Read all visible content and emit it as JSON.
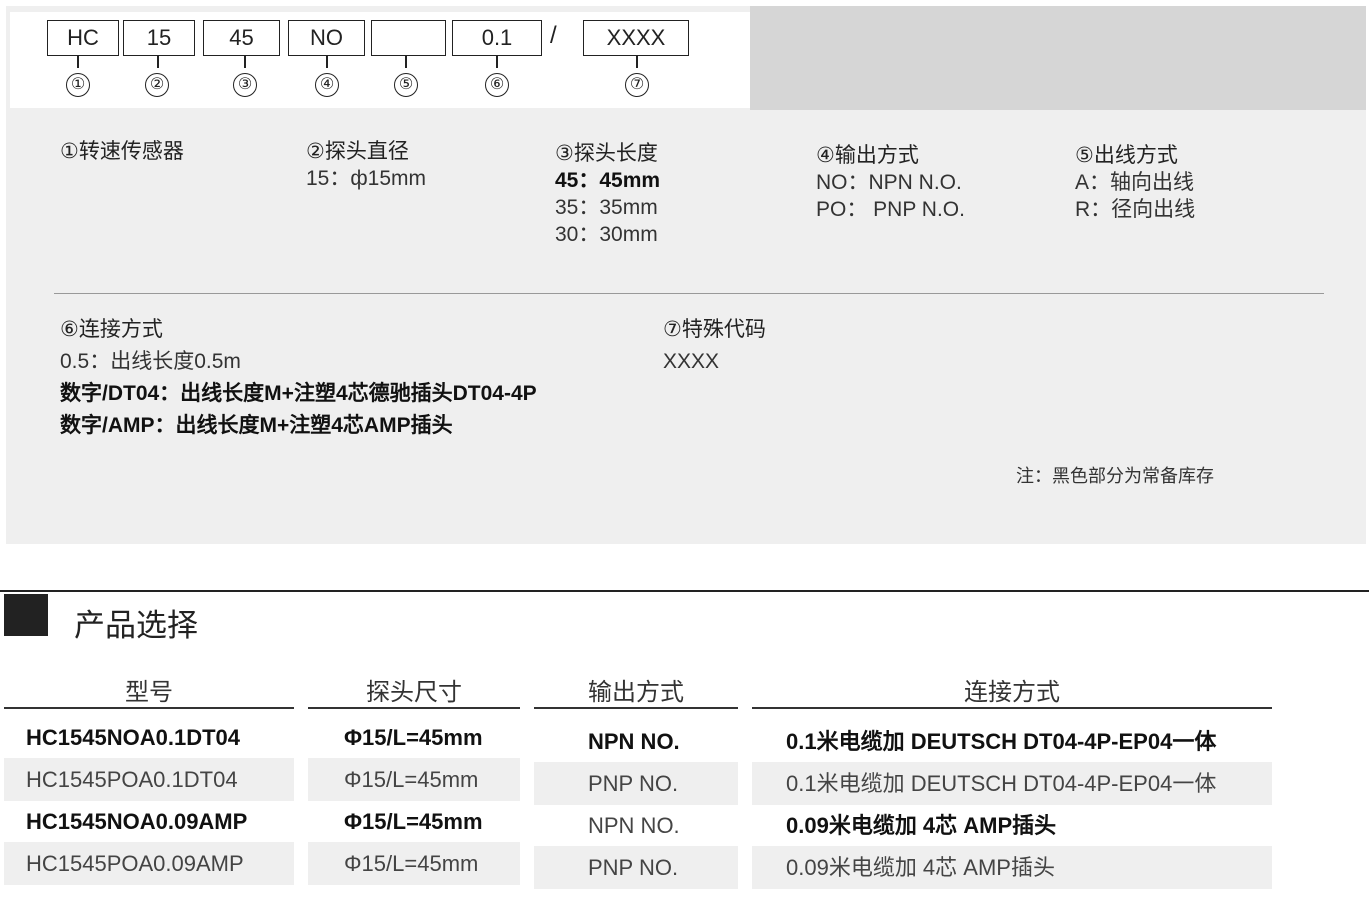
{
  "code": {
    "boxes": [
      "HC",
      "15",
      "45",
      "NO",
      "",
      "0.1",
      "XXXX"
    ],
    "slash": "/",
    "markers": [
      "①",
      "②",
      "③",
      "④",
      "⑤",
      "⑥",
      "⑦"
    ]
  },
  "params": {
    "p1": {
      "heading": "①转速传感器"
    },
    "p2": {
      "heading": "②探头直径",
      "lines": [
        "15：ф15mm"
      ]
    },
    "p3": {
      "heading": "③探头长度",
      "lines": [
        "45：45mm",
        "35：35mm",
        "30：30mm"
      ]
    },
    "p4": {
      "heading": "④输出方式",
      "lines": [
        "NO：NPN N.O.",
        "PO：  PNP N.O."
      ]
    },
    "p5": {
      "heading": "⑤出线方式",
      "lines": [
        "A：轴向出线",
        "R：径向出线"
      ]
    },
    "p6": {
      "heading": "⑥连接方式",
      "lines": [
        "0.5：出线长度0.5m",
        "数字/DT04：出线长度M+注塑4芯德驰插头DT04-4P",
        "数字/AMP：出线长度M+注塑4芯AMP插头"
      ]
    },
    "p7": {
      "heading": "⑦特殊代码",
      "lines": [
        "XXXX"
      ]
    }
  },
  "note": "注：黑色部分为常备库存",
  "section": {
    "title": "产品选择"
  },
  "table": {
    "headers": [
      "型号",
      "探头尺寸",
      "输出方式",
      "连接方式"
    ],
    "rows": [
      [
        "HC1545NOA0.1DT04",
        "Φ15/L=45mm",
        "NPN NO.",
        "0.1米电缆加 DEUTSCH DT04-4P-EP04一体"
      ],
      [
        "HC1545POA0.1DT04",
        "Φ15/L=45mm",
        "PNP NO.",
        "0.1米电缆加 DEUTSCH DT04-4P-EP04一体"
      ],
      [
        "HC1545NOA0.09AMP",
        "Φ15/L=45mm",
        "NPN NO.",
        "0.09米电缆加 4芯 AMP插头"
      ],
      [
        "HC1545POA0.09AMP",
        "Φ15/L=45mm",
        "PNP NO.",
        "0.09米电缆加 4芯 AMP插头"
      ]
    ]
  }
}
